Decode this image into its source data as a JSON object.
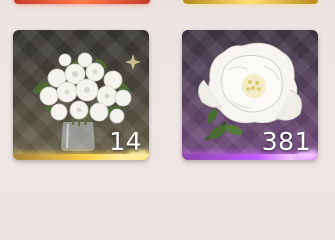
{
  "items": [
    {
      "name": "white-flower-bouquet",
      "quantity": "14",
      "rarity_color": "#ffd24a",
      "icon": "bouquet-in-vase-icon"
    },
    {
      "name": "white-rose",
      "quantity": "381",
      "rarity_color": "#c25cff",
      "icon": "white-rose-icon"
    }
  ]
}
